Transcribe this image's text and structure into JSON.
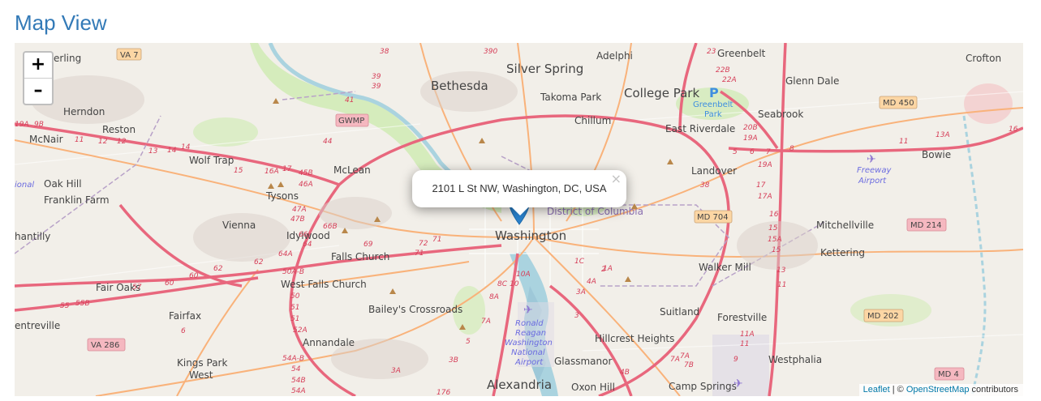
{
  "page": {
    "title": "Map View"
  },
  "zoom": {
    "in_label": "+",
    "out_label": "–"
  },
  "popup": {
    "address": "2101 L St NW, Washington, DC, USA",
    "close_label": "×"
  },
  "attribution": {
    "leaflet": "Leaflet",
    "separator": " | © ",
    "osm": "OpenStreetMap",
    "suffix": " contributors"
  },
  "colors": {
    "title": "#337ab7",
    "marker": "#2a81cb",
    "link": "#0078a8",
    "map_bg": "#f2efe9",
    "motorway": "#e8677d",
    "primary": "#f9b27a",
    "water": "#aad3df",
    "park": "#cdebb0"
  },
  "map": {
    "places": {
      "silver_spring": "Silver Spring",
      "bethesda": "Bethesda",
      "college_park": "College Park",
      "washington": "Washington",
      "district": "District of Columbia",
      "alexandria": "Alexandria",
      "mclean": "McLean",
      "vienna": "Vienna",
      "tysons": "Tysons",
      "reston": "Reston",
      "herndon": "Herndon",
      "fairfax": "Fairfax",
      "fair_oaks": "Fair Oaks",
      "falls_church": "Falls Church",
      "west_falls_church": "West Falls Church",
      "baileys": "Bailey's Crossroads",
      "annandale": "Annandale",
      "kings_park": "Kings Park",
      "kings_park_west": "West",
      "idylwood": "Idylwood",
      "wolf_trap": "Wolf Trap",
      "oak_hill": "Oak Hill",
      "franklin_farm": "Franklin Farm",
      "mcnair": "McNair",
      "sterling": "erling",
      "chantilly": "hantilly",
      "centreville": "entreville",
      "adelphi": "Adelphi",
      "takoma_park": "Takoma Park",
      "chillum": "Chillum",
      "east_riverdale": "East Riverdale",
      "greenbelt": "Greenbelt",
      "glenn_dale": "Glenn Dale",
      "seabrook": "Seabrook",
      "crofton": "Crofton",
      "bowie": "Bowie",
      "landover": "Landover",
      "mitchellville": "Mitchellville",
      "kettering": "Kettering",
      "walker_mill": "Walker Mill",
      "suitland": "Suitland",
      "forestville": "Forestville",
      "hillcrest": "Hillcrest Heights",
      "glassmanor": "Glassmanor",
      "oxon_hill": "Oxon Hill",
      "camp_springs": "Camp Springs",
      "westphalia": "Westphalia",
      "greenbelt_park": "Greenbelt",
      "greenbelt_park2": "Park",
      "freeway_airport": "Freeway",
      "freeway_airport2": "Airport",
      "reagan1": "Ronald",
      "reagan2": "Reagan",
      "reagan3": "Washington",
      "reagan4": "National",
      "reagan5": "Airport",
      "ional": "ional"
    },
    "shields": {
      "va7": "VA 7",
      "gwmp": "GWMP",
      "md450": "MD 450",
      "md704": "MD 704",
      "md214": "MD 214",
      "md202": "MD 202",
      "md4": "MD 4",
      "va286": "VA 286"
    }
  }
}
